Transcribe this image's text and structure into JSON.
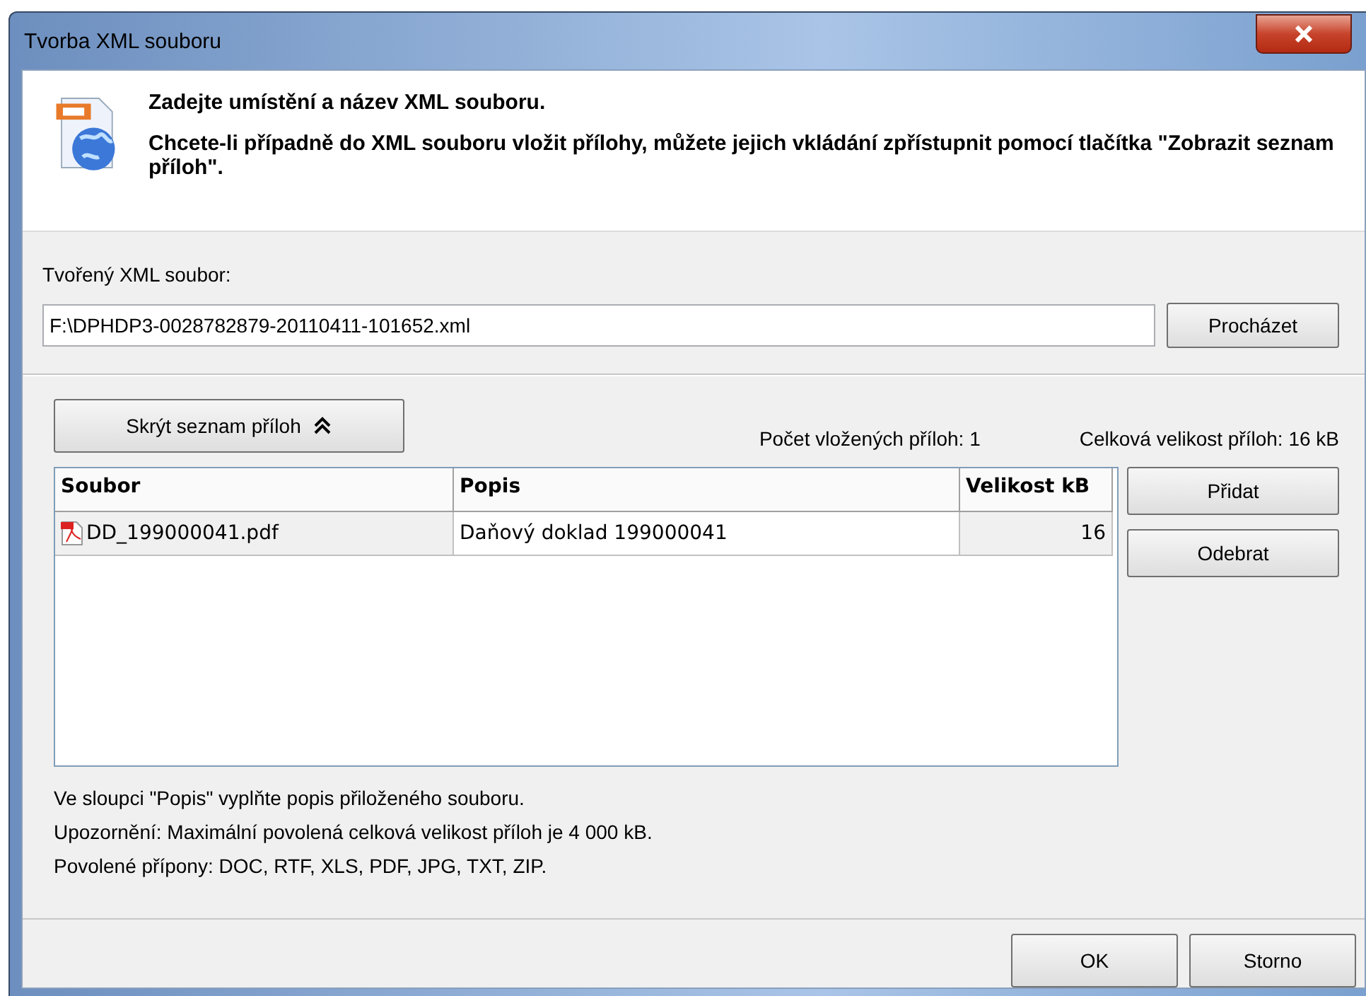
{
  "window": {
    "title": "Tvorba XML souboru"
  },
  "header": {
    "title": "Zadejte umístění a název XML souboru.",
    "text": "Chcete-li případně do XML souboru vložit přílohy, můžete jejich vkládání zpřístupnit pomocí tlačítka \"Zobrazit seznam příloh\"."
  },
  "file": {
    "label": "Tvořený XML soubor:",
    "value": "F:\\DPHDP3-0028782879-20110411-101652.xml",
    "browse_button": "Procházet"
  },
  "attachments": {
    "toggle_button": "Skrýt seznam příloh",
    "count": "Počet vložených příloh: 1",
    "total_size": "Celková velikost příloh: 16 kB",
    "columns": [
      "Soubor",
      "Popis",
      "Velikost kB"
    ],
    "rows": [
      {
        "file": "DD_199000041.pdf",
        "description": "Daňový doklad 199000041",
        "size": "16"
      }
    ],
    "buttons": [
      "Přidat",
      "Odebrat"
    ]
  },
  "notes": [
    "Ve sloupci \"Popis\" vyplňte popis přiloženého souboru.",
    "Upozornění: Maximální povolená celková velikost příloh je 4 000 kB.",
    "Povolené přípony: DOC, RTF, XLS, PDF, JPG, TXT, ZIP."
  ],
  "buttons": [
    "OK",
    "Storno"
  ]
}
